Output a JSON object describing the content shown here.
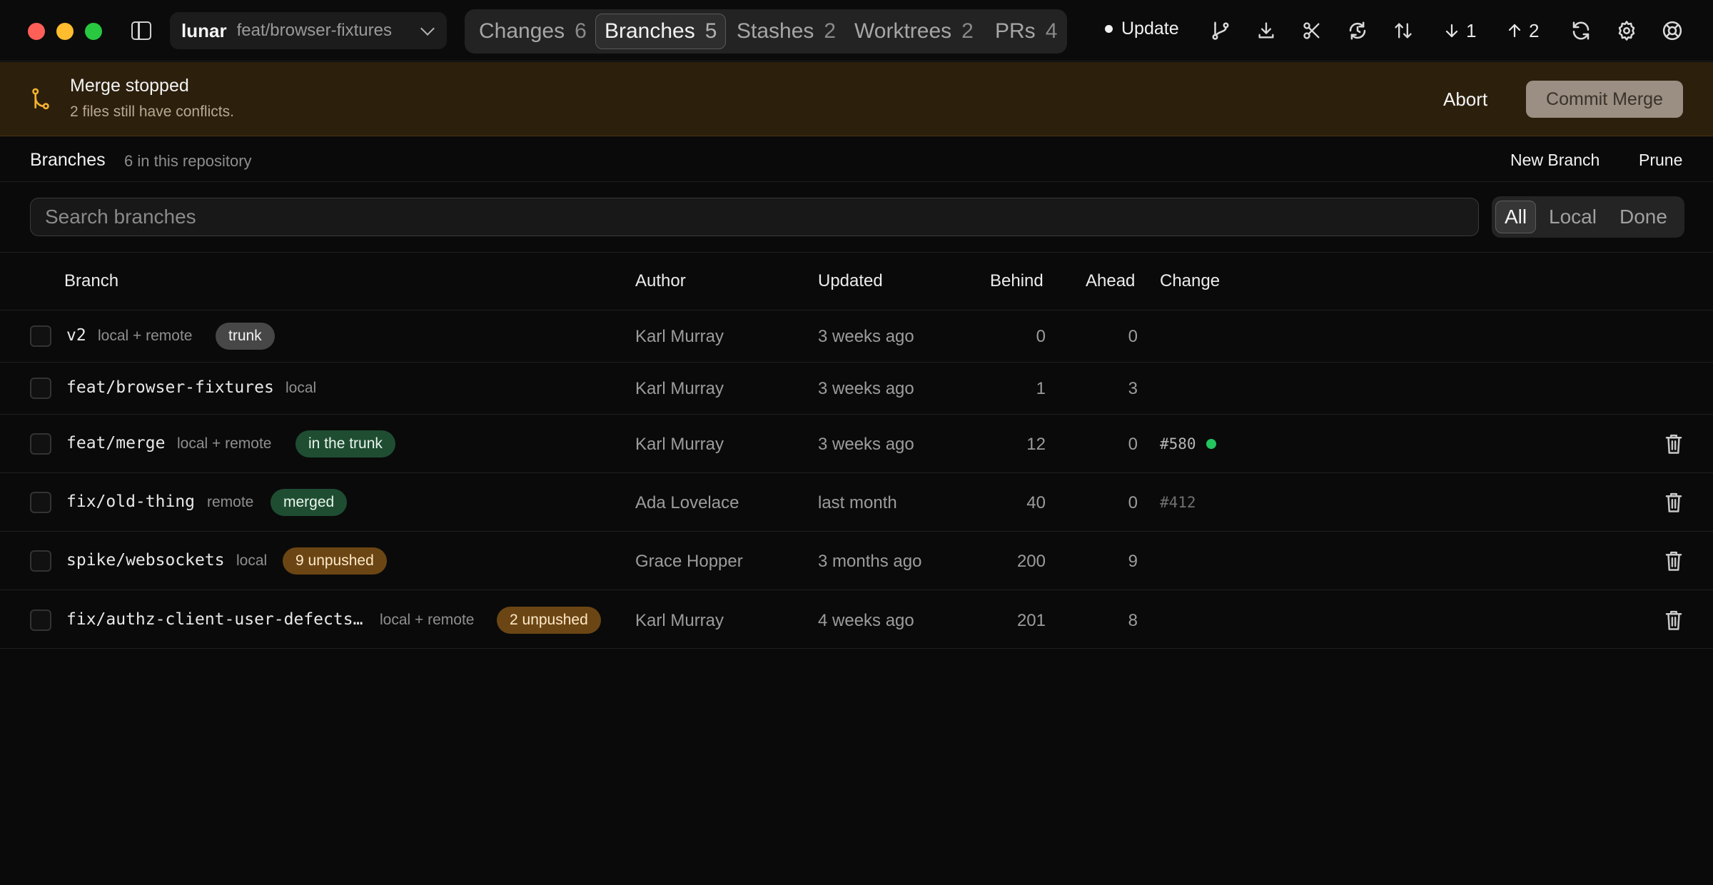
{
  "titlebar": {
    "repo_name": "lunar",
    "current_branch": "feat/browser-fixtures",
    "tabs": [
      {
        "label": "Changes",
        "count": "6",
        "active": false
      },
      {
        "label": "Branches",
        "count": "5",
        "active": true
      },
      {
        "label": "Stashes",
        "count": "2",
        "active": false
      },
      {
        "label": "Worktrees",
        "count": "2",
        "active": false
      },
      {
        "label": "PRs",
        "count": "4",
        "active": false
      }
    ],
    "update_label": "Update",
    "pull_count": "1",
    "push_count": "2",
    "icons": [
      "branch-fork-icon",
      "download-icon",
      "scissors-icon",
      "refresh-history-icon",
      "sort-arrows-icon",
      "arrow-down-icon",
      "arrow-up-icon",
      "sync-icon",
      "gear-icon",
      "help-lifebuoy-icon"
    ]
  },
  "banner": {
    "title": "Merge stopped",
    "subtitle": "2 files still have conflicts.",
    "abort_label": "Abort",
    "commit_label": "Commit Merge"
  },
  "subheader": {
    "title": "Branches",
    "count_text": "6 in this repository",
    "new_branch_label": "New Branch",
    "prune_label": "Prune"
  },
  "search": {
    "placeholder": "Search branches"
  },
  "filters": [
    "All",
    "Local",
    "Done"
  ],
  "columns": {
    "branch": "Branch",
    "author": "Author",
    "updated": "Updated",
    "behind": "Behind",
    "ahead": "Ahead",
    "change": "Change"
  },
  "rows": [
    {
      "name": "v2",
      "location": "local + remote",
      "badge": "trunk",
      "author": "Karl Murray",
      "updated": "3 weeks ago",
      "behind": "0",
      "ahead": "0",
      "change": ""
    },
    {
      "name": "feat/browser-fixtures",
      "location": "local",
      "badge": "",
      "author": "Karl Murray",
      "updated": "3 weeks ago",
      "behind": "1",
      "ahead": "3",
      "change": ""
    },
    {
      "name": "feat/merge",
      "location": "local + remote",
      "badge": "in the trunk",
      "author": "Karl Murray",
      "updated": "3 weeks ago",
      "behind": "12",
      "ahead": "0",
      "change": "#580"
    },
    {
      "name": "fix/old-thing",
      "location": "remote",
      "badge": "merged",
      "author": "Ada Lovelace",
      "updated": "last month",
      "behind": "40",
      "ahead": "0",
      "change": "#412"
    },
    {
      "name": "spike/websockets",
      "location": "local",
      "badge": "9 unpushed",
      "author": "Grace Hopper",
      "updated": "3 months ago",
      "behind": "200",
      "ahead": "9",
      "change": ""
    },
    {
      "name": "fix/authz-client-user-defects…",
      "location": "local + remote",
      "badge": "2 unpushed",
      "author": "Karl Murray",
      "updated": "4 weeks ago",
      "behind": "201",
      "ahead": "8",
      "change": ""
    }
  ],
  "colors": {
    "background": "#0a0a0a",
    "banner_bg": "#2c1f0c",
    "trunk_badge": "#474747",
    "green_badge": "#1f4d32",
    "amber_badge": "#6b4614",
    "status_dot": "#22c55e",
    "merge_icon": "#f2b230"
  }
}
